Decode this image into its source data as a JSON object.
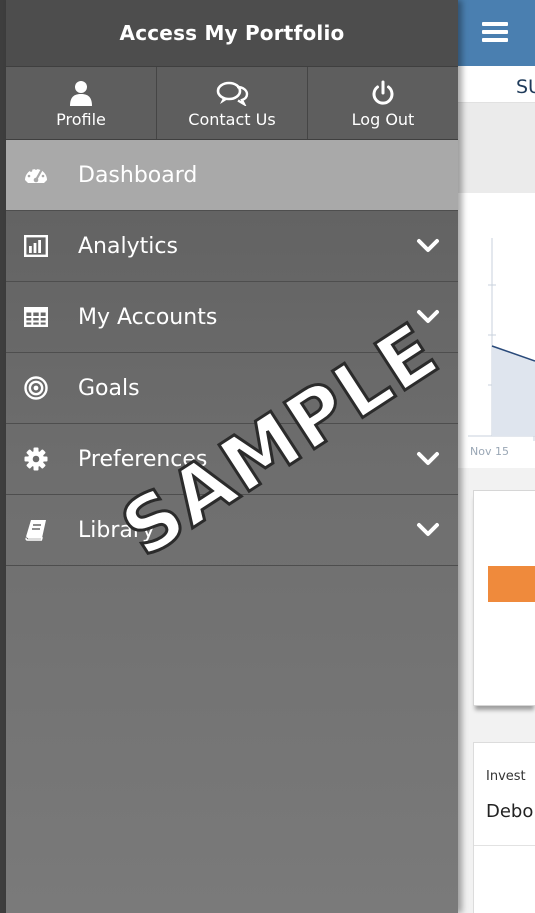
{
  "drawer": {
    "title": "Access My Portfolio",
    "quick_actions": [
      {
        "label": "Profile",
        "icon": "user-icon"
      },
      {
        "label": "Contact Us",
        "icon": "chat-bubbles-icon"
      },
      {
        "label": "Log Out",
        "icon": "power-icon"
      }
    ],
    "nav": [
      {
        "label": "Dashboard",
        "icon": "dashboard-gauge-icon",
        "active": true,
        "expandable": false
      },
      {
        "label": "Analytics",
        "icon": "bar-chart-icon",
        "active": false,
        "expandable": true
      },
      {
        "label": "My Accounts",
        "icon": "table-grid-icon",
        "active": false,
        "expandable": true
      },
      {
        "label": "Goals",
        "icon": "target-icon",
        "active": false,
        "expandable": false
      },
      {
        "label": "Preferences",
        "icon": "gear-icon",
        "active": false,
        "expandable": true
      },
      {
        "label": "Library",
        "icon": "book-icon",
        "active": false,
        "expandable": true
      }
    ]
  },
  "background": {
    "summary_title": "SU",
    "chart_start_label": "Nov 15",
    "invest_label": "Invest",
    "invest_name": "Debo"
  },
  "watermark": "SAMPLE",
  "colors": {
    "header_blue": "#4a7fb0",
    "drawer_bg": "#5a5a5a",
    "active_item": "#a9a9a9",
    "orange_bar": "#ef8a3c"
  }
}
